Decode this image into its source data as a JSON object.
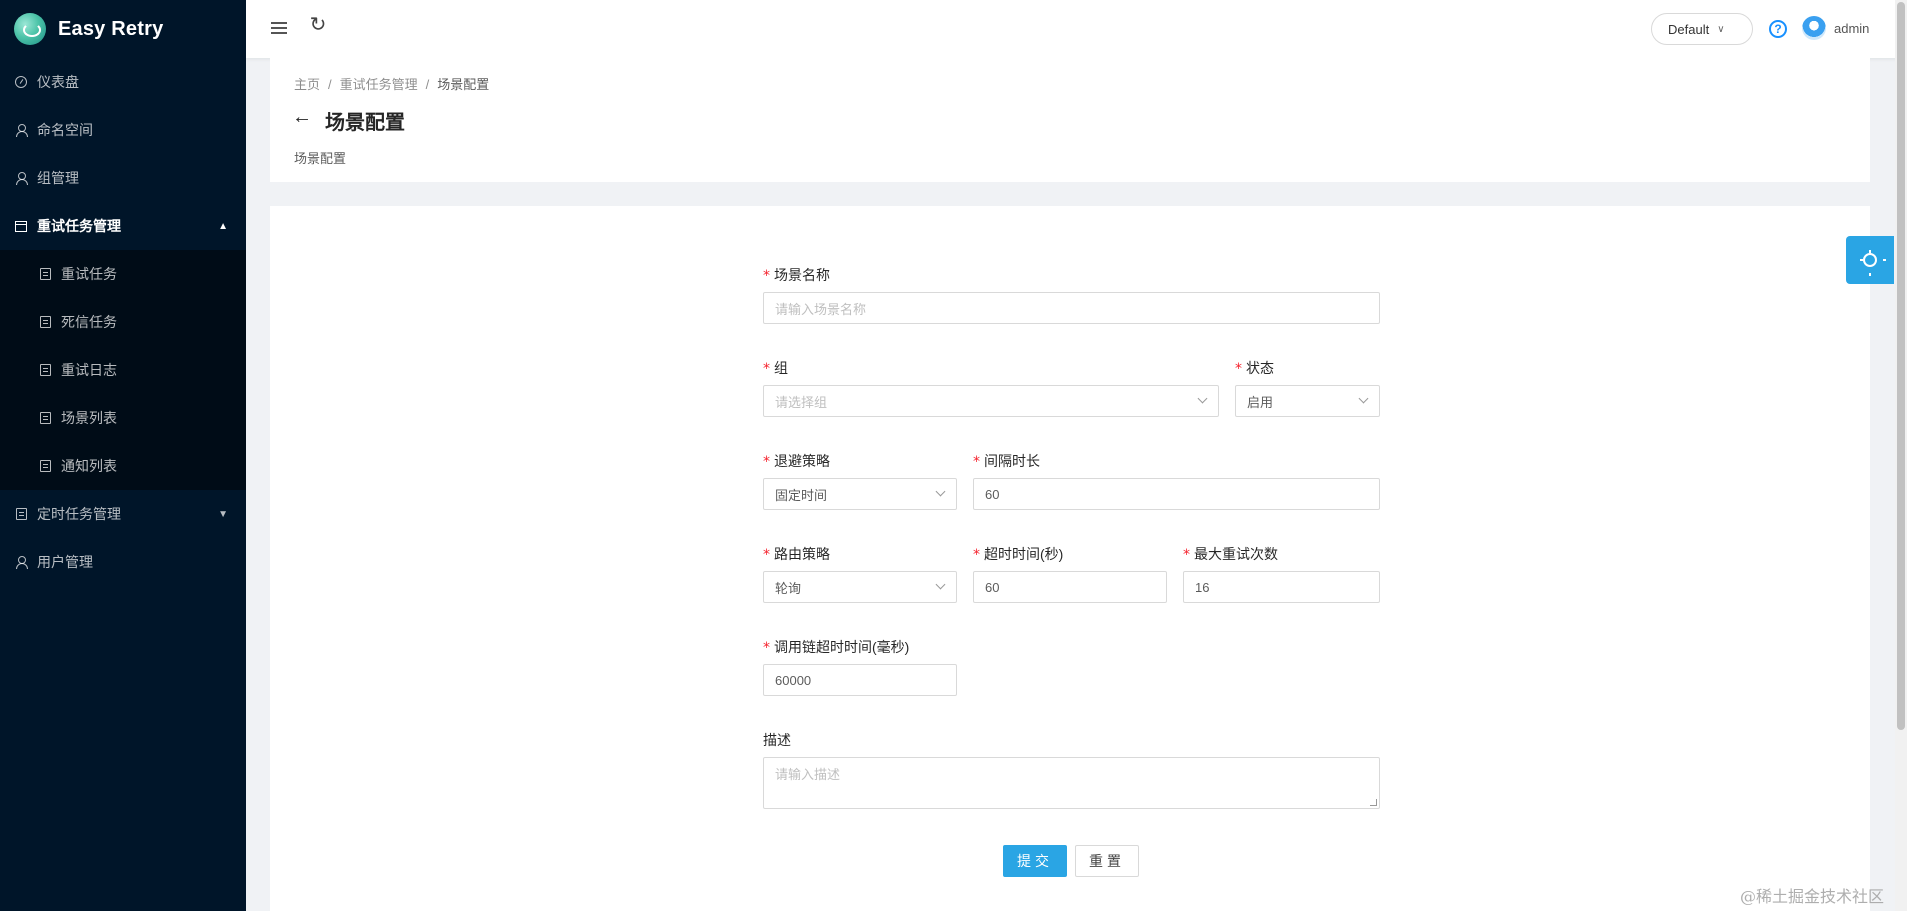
{
  "app": {
    "logo_text": "Easy Retry"
  },
  "sidebar": {
    "items": [
      {
        "label": "仪表盘",
        "icon": "dashboard-icon"
      },
      {
        "label": "命名空间",
        "icon": "person-icon"
      },
      {
        "label": "组管理",
        "icon": "person-icon"
      },
      {
        "label": "重试任务管理",
        "icon": "calendar-icon",
        "expanded": true,
        "children": [
          {
            "label": "重试任务"
          },
          {
            "label": "死信任务"
          },
          {
            "label": "重试日志"
          },
          {
            "label": "场景列表"
          },
          {
            "label": "通知列表"
          }
        ]
      },
      {
        "label": "定时任务管理",
        "icon": "table-icon",
        "expanded": false
      },
      {
        "label": "用户管理",
        "icon": "user-icon"
      }
    ]
  },
  "header": {
    "workspace": "Default",
    "user": "admin"
  },
  "breadcrumb": [
    "主页",
    "重试任务管理",
    "场景配置"
  ],
  "breadcrumb_sep": "/",
  "page": {
    "title": "场景配置",
    "description": "场景配置"
  },
  "form": {
    "scene_name": {
      "label": "场景名称",
      "placeholder": "请输入场景名称"
    },
    "group": {
      "label": "组",
      "placeholder": "请选择组"
    },
    "status": {
      "label": "状态",
      "value": "启用"
    },
    "backoff": {
      "label": "退避策略",
      "value": "固定时间"
    },
    "interval": {
      "label": "间隔时长",
      "value": "60"
    },
    "route": {
      "label": "路由策略",
      "value": "轮询"
    },
    "timeout": {
      "label": "超时时间(秒)",
      "value": "60"
    },
    "max_retry": {
      "label": "最大重试次数",
      "value": "16"
    },
    "chain_timeout": {
      "label": "调用链超时时间(毫秒)",
      "value": "60000"
    },
    "description": {
      "label": "描述",
      "placeholder": "请输入描述"
    },
    "required_mark": "*",
    "submit": "提交",
    "reset": "重置"
  },
  "watermark": "@稀土掘金技术社区",
  "colors": {
    "sidebar_bg": "#001529",
    "primary": "#2aa5e4",
    "required": "#f5222d"
  }
}
